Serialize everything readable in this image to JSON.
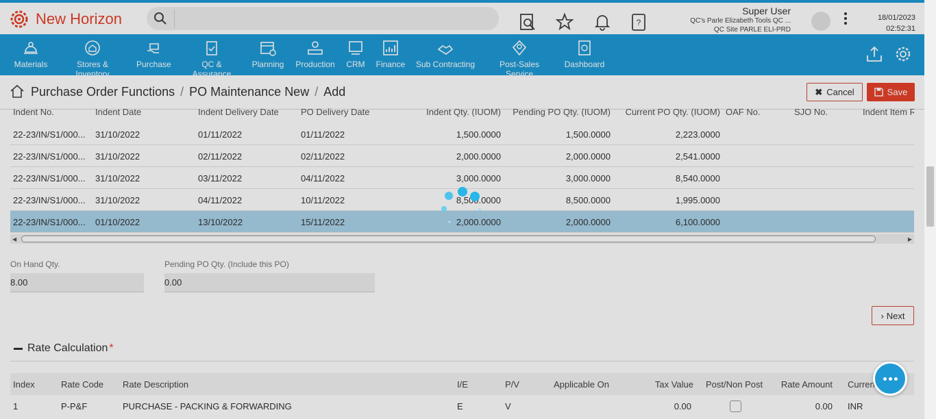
{
  "app": {
    "title": "New Horizon"
  },
  "search": {
    "placeholder": ""
  },
  "user": {
    "name": "Super User",
    "company": "QC's Parle Elizabeth Tools QC ...",
    "site": "QC Site PARLE ELI-PRD",
    "date": "18/01/2023",
    "time": "02:52:31"
  },
  "header_icons": [
    "report-search-icon",
    "star-icon",
    "bell-icon",
    "help-book-icon"
  ],
  "nav": {
    "items": [
      {
        "label": "Materials",
        "icon": "materials-icon"
      },
      {
        "label": "Stores & Inventory",
        "icon": "stores-icon"
      },
      {
        "label": "Purchase",
        "icon": "purchase-icon"
      },
      {
        "label": "QC & Assurance",
        "icon": "qc-icon"
      },
      {
        "label": "Planning",
        "icon": "planning-icon"
      },
      {
        "label": "Production",
        "icon": "production-icon"
      },
      {
        "label": "CRM",
        "icon": "crm-icon"
      },
      {
        "label": "Finance",
        "icon": "finance-icon"
      },
      {
        "label": "Sub Contracting",
        "icon": "subcontracting-icon"
      },
      {
        "label": "Post-Sales Service",
        "icon": "post-sales-icon"
      },
      {
        "label": "Dashboard",
        "icon": "dashboard-icon"
      }
    ]
  },
  "breadcrumb": {
    "items": [
      "Purchase Order Functions",
      "PO Maintenance New",
      "Add"
    ],
    "separator": "/"
  },
  "actions": {
    "cancel": "Cancel",
    "save": "Save",
    "next": "Next"
  },
  "indent_grid": {
    "columns": [
      "Indent No.",
      "Indent Date",
      "Indent Delivery Date",
      "PO Delivery Date",
      "Indent Qty. (IUOM)",
      "Pending PO Qty. (IUOM)",
      "Current PO Qty. (IUOM)",
      "OAF No.",
      "SJO No.",
      "Indent Item R"
    ],
    "rows": [
      {
        "indent_no": "22-23/IN/S1/000...",
        "indent_date": "31/10/2022",
        "indent_delivery": "01/11/2022",
        "po_delivery": "01/11/2022",
        "indent_qty": "1,500.0000",
        "pending_qty": "1,500.0000",
        "current_qty": "2,223.0000",
        "selected": false
      },
      {
        "indent_no": "22-23/IN/S1/000...",
        "indent_date": "31/10/2022",
        "indent_delivery": "02/11/2022",
        "po_delivery": "02/11/2022",
        "indent_qty": "2,000.0000",
        "pending_qty": "2,000.0000",
        "current_qty": "2,541.0000",
        "selected": false
      },
      {
        "indent_no": "22-23/IN/S1/000...",
        "indent_date": "31/10/2022",
        "indent_delivery": "03/11/2022",
        "po_delivery": "04/11/2022",
        "indent_qty": "3,000.0000",
        "pending_qty": "3,000.0000",
        "current_qty": "8,540.0000",
        "selected": false
      },
      {
        "indent_no": "22-23/IN/S1/000...",
        "indent_date": "31/10/2022",
        "indent_delivery": "04/11/2022",
        "po_delivery": "10/11/2022",
        "indent_qty": "8,500.0000",
        "pending_qty": "8,500.0000",
        "current_qty": "1,995.0000",
        "selected": false
      },
      {
        "indent_no": "22-23/IN/S1/000...",
        "indent_date": "01/10/2022",
        "indent_delivery": "13/10/2022",
        "po_delivery": "15/11/2022",
        "indent_qty": "2,000.0000",
        "pending_qty": "2,000.0000",
        "current_qty": "6,100.0000",
        "selected": true
      }
    ]
  },
  "qty_fields": {
    "on_hand_label": "On Hand Qty.",
    "on_hand_value": "8.00",
    "pending_label": "Pending PO Qty. (Include this PO)",
    "pending_value": "0.00"
  },
  "rate_calc": {
    "title": "Rate Calculation",
    "required_mark": "*",
    "columns": [
      "Index",
      "Rate Code",
      "Rate Description",
      "I/E",
      "P/V",
      "Applicable On",
      "Tax Value",
      "Post/Non Post",
      "Rate Amount",
      "Curren"
    ],
    "rows": [
      {
        "index": "1",
        "rate_code": "P-P&F",
        "description": "PURCHASE - PACKING & FORWARDING",
        "ie": "E",
        "pv": "V",
        "applicable_on": "",
        "tax_value": "0.00",
        "post": false,
        "rate_amount": "0.00",
        "currency": "INR"
      }
    ]
  },
  "colors": {
    "brand": "#1e9ad6",
    "accent": "#e8412a",
    "selected_row": "#aad3ea"
  }
}
